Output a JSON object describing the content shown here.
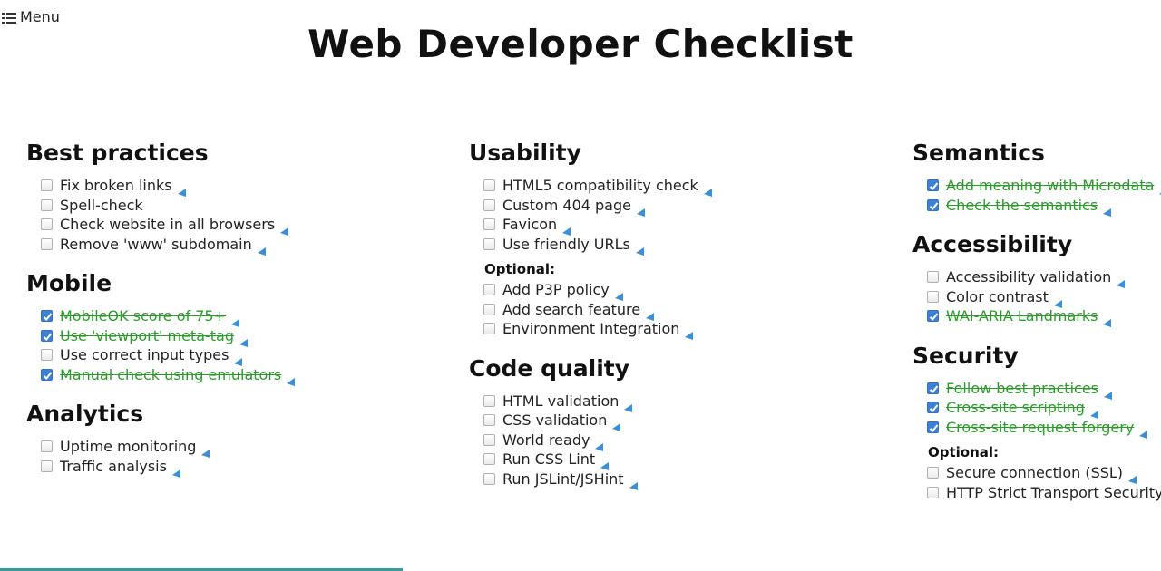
{
  "menu": {
    "label": "Menu",
    "icon": "list-icon"
  },
  "title": "Web Developer Checklist",
  "colors": {
    "done_text": "#2e9a2e",
    "checkbox_checked": "#3b82d6",
    "arrow": "#3a8fd8",
    "heading": "#111111"
  },
  "columns": [
    {
      "sections": [
        {
          "heading": "Best practices",
          "items": [
            {
              "label": "Fix broken links",
              "checked": false,
              "arrow": true
            },
            {
              "label": "Spell-check",
              "checked": false,
              "arrow": false
            },
            {
              "label": "Check website in all browsers",
              "checked": false,
              "arrow": true
            },
            {
              "label": "Remove 'www' subdomain",
              "checked": false,
              "arrow": true
            }
          ]
        },
        {
          "heading": "Mobile",
          "items": [
            {
              "label": "MobileOK score of 75+",
              "checked": true,
              "arrow": true
            },
            {
              "label": "Use 'viewport' meta-tag",
              "checked": true,
              "arrow": true
            },
            {
              "label": "Use correct input types",
              "checked": false,
              "arrow": true
            },
            {
              "label": "Manual check using emulators",
              "checked": true,
              "arrow": true
            }
          ]
        },
        {
          "heading": "Analytics",
          "items": [
            {
              "label": "Uptime monitoring",
              "checked": false,
              "arrow": true
            },
            {
              "label": "Traffic analysis",
              "checked": false,
              "arrow": true
            }
          ]
        }
      ]
    },
    {
      "sections": [
        {
          "heading": "Usability",
          "items": [
            {
              "label": "HTML5 compatibility check",
              "checked": false,
              "arrow": true
            },
            {
              "label": "Custom 404 page",
              "checked": false,
              "arrow": true
            },
            {
              "label": "Favicon",
              "checked": false,
              "arrow": true
            },
            {
              "label": "Use friendly URLs",
              "checked": false,
              "arrow": true
            }
          ],
          "optional_label": "Optional:",
          "optional_items": [
            {
              "label": "Add P3P policy",
              "checked": false,
              "arrow": true
            },
            {
              "label": "Add search feature",
              "checked": false,
              "arrow": true
            },
            {
              "label": "Environment Integration",
              "checked": false,
              "arrow": true
            }
          ]
        },
        {
          "heading": "Code quality",
          "items": [
            {
              "label": "HTML validation",
              "checked": false,
              "arrow": true
            },
            {
              "label": "CSS validation",
              "checked": false,
              "arrow": true
            },
            {
              "label": "World ready",
              "checked": false,
              "arrow": true
            },
            {
              "label": "Run CSS Lint",
              "checked": false,
              "arrow": true
            },
            {
              "label": "Run JSLint/JSHint",
              "checked": false,
              "arrow": true
            }
          ]
        }
      ]
    },
    {
      "sections": [
        {
          "heading": "Semantics",
          "items": [
            {
              "label": "Add meaning with Microdata",
              "checked": true,
              "arrow": true
            },
            {
              "label": "Check the semantics",
              "checked": true,
              "arrow": true
            }
          ]
        },
        {
          "heading": "Accessibility",
          "items": [
            {
              "label": "Accessibility validation",
              "checked": false,
              "arrow": true
            },
            {
              "label": "Color contrast",
              "checked": false,
              "arrow": true
            },
            {
              "label": "WAI-ARIA Landmarks",
              "checked": true,
              "arrow": true
            }
          ]
        },
        {
          "heading": "Security",
          "items": [
            {
              "label": "Follow best practices",
              "checked": true,
              "arrow": true
            },
            {
              "label": "Cross-site scripting",
              "checked": true,
              "arrow": true
            },
            {
              "label": "Cross-site request forgery",
              "checked": true,
              "arrow": true
            }
          ],
          "optional_label": "Optional:",
          "optional_items": [
            {
              "label": "Secure connection (SSL)",
              "checked": false,
              "arrow": true
            },
            {
              "label": "HTTP Strict Transport Security",
              "checked": false,
              "arrow": true
            }
          ]
        }
      ]
    }
  ]
}
